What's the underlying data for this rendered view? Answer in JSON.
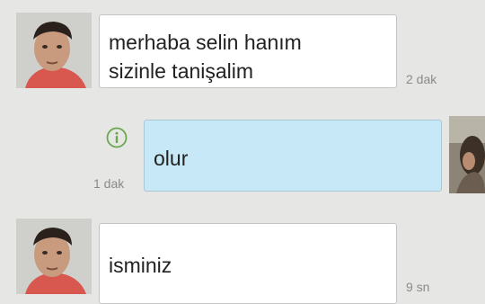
{
  "messages": [
    {
      "id": "m1",
      "sender": "contact",
      "lines": [
        "merhaba selin hanım",
        "sizinle tanişalim"
      ],
      "time": "2 dak"
    },
    {
      "id": "m2",
      "sender": "me",
      "lines": [
        "olur"
      ],
      "time": "1 dak",
      "status_icon": "info-icon"
    },
    {
      "id": "m3",
      "sender": "contact",
      "lines": [
        "isminiz"
      ],
      "time": "9 sn"
    }
  ],
  "colors": {
    "background": "#e6e6e4",
    "incoming_bubble": "#ffffff",
    "outgoing_bubble": "#c7e8f6",
    "info_icon": "#6aa84f",
    "timestamp": "#8a8a8a"
  }
}
